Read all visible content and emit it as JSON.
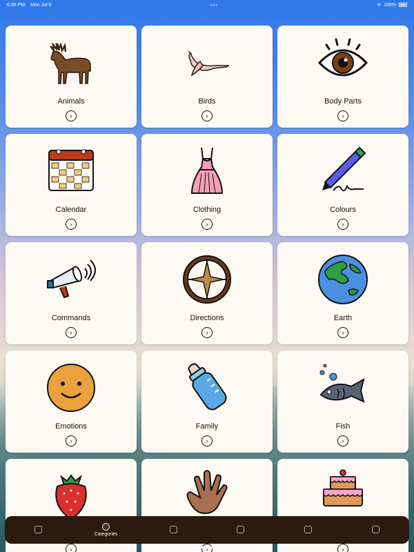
{
  "status_bar": {
    "time": "6:36 PM",
    "date": "Mon Jul 8",
    "battery": "100%"
  },
  "categories": [
    {
      "label": "Animals",
      "icon": "moose-icon"
    },
    {
      "label": "Birds",
      "icon": "flamingo-icon"
    },
    {
      "label": "Body Parts",
      "icon": "eye-icon"
    },
    {
      "label": "Calendar",
      "icon": "calendar-icon"
    },
    {
      "label": "Clothing",
      "icon": "dress-icon"
    },
    {
      "label": "Colours",
      "icon": "crayon-icon"
    },
    {
      "label": "Commands",
      "icon": "megaphone-icon"
    },
    {
      "label": "Directions",
      "icon": "compass-icon"
    },
    {
      "label": "Earth",
      "icon": "globe-icon"
    },
    {
      "label": "Emotions",
      "icon": "smiley-icon"
    },
    {
      "label": "Family",
      "icon": "baby-bottle-icon"
    },
    {
      "label": "Fish",
      "icon": "fish-icon"
    },
    {
      "label": "",
      "icon": "strawberry-icon"
    },
    {
      "label": "",
      "icon": "hand-icon"
    },
    {
      "label": "",
      "icon": "cake-icon"
    }
  ],
  "tabs": [
    {
      "label": "",
      "icon": "home-icon"
    },
    {
      "label": "Categories",
      "icon": "categories-icon",
      "active": true
    },
    {
      "label": "",
      "icon": "book-icon"
    },
    {
      "label": "",
      "icon": "quiz-icon"
    },
    {
      "label": "",
      "icon": "info-icon"
    },
    {
      "label": "",
      "icon": "settings-icon"
    }
  ],
  "colors": {
    "card": "#fdf9f3",
    "tabbar": "#2b1a10",
    "sky": "#2f78e8"
  }
}
